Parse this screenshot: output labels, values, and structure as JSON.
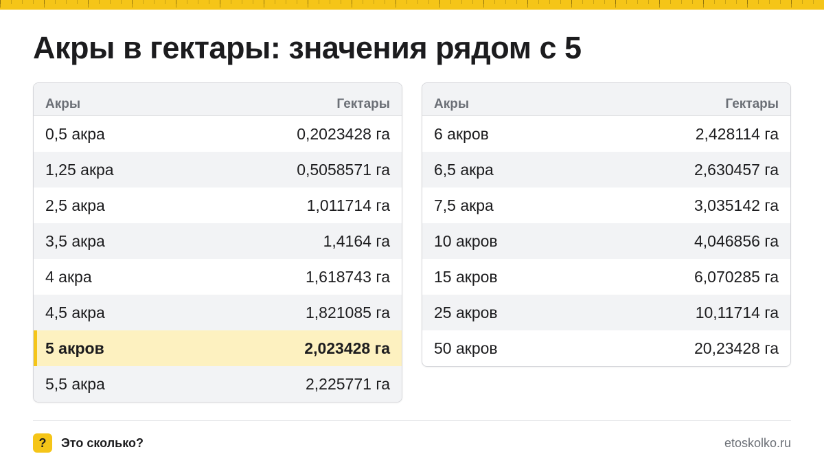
{
  "title": "Акры в гектары: значения рядом с 5",
  "left_table": {
    "header": {
      "col1": "Акры",
      "col2": "Гектары"
    },
    "rows": [
      {
        "acres": "0,5 акра",
        "hectares": "0,2023428 га"
      },
      {
        "acres": "1,25 акра",
        "hectares": "0,5058571 га"
      },
      {
        "acres": "2,5 акра",
        "hectares": "1,011714 га"
      },
      {
        "acres": "3,5 акра",
        "hectares": "1,4164 га"
      },
      {
        "acres": "4 акра",
        "hectares": "1,618743 га"
      },
      {
        "acres": "4,5 акра",
        "hectares": "1,821085 га"
      },
      {
        "acres": "5 акров",
        "hectares": "2,023428 га",
        "highlighted": true
      },
      {
        "acres": "5,5 акра",
        "hectares": "2,225771 га"
      }
    ]
  },
  "right_table": {
    "header": {
      "col1": "Акры",
      "col2": "Гектары"
    },
    "rows": [
      {
        "acres": "6 акров",
        "hectares": "2,428114 га"
      },
      {
        "acres": "6,5 акра",
        "hectares": "2,630457 га"
      },
      {
        "acres": "7,5 акра",
        "hectares": "3,035142 га"
      },
      {
        "acres": "10 акров",
        "hectares": "4,046856 га"
      },
      {
        "acres": "15 акров",
        "hectares": "6,070285 га"
      },
      {
        "acres": "25 акров",
        "hectares": "10,11714 га"
      },
      {
        "acres": "50 акров",
        "hectares": "20,23428 га"
      }
    ]
  },
  "footer": {
    "badge": "?",
    "brand": "Это сколько?",
    "site": "etoskolko.ru"
  },
  "colors": {
    "accent": "#f5c518",
    "highlight_row": "#fdf1c0",
    "alt_row": "#f2f3f5",
    "muted_text": "#6b6f76"
  }
}
